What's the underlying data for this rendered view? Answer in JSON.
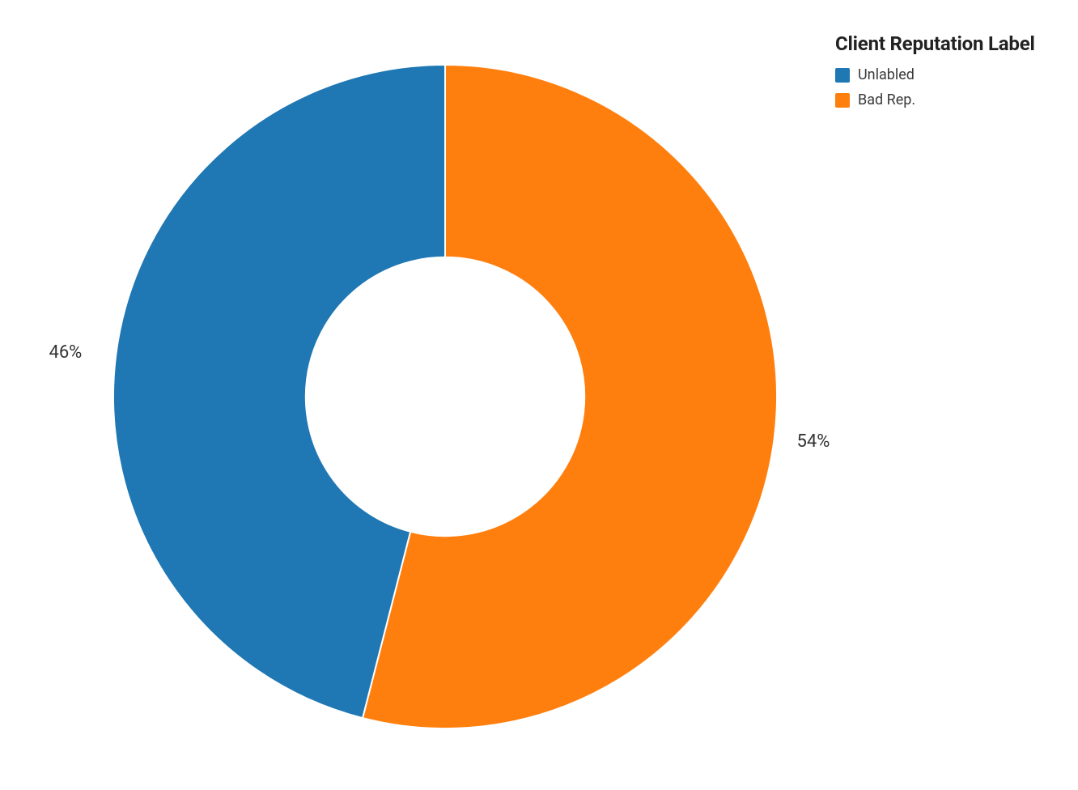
{
  "chart_data": {
    "type": "pie",
    "title": "",
    "legend_title": "Client Reputation Label",
    "inner_radius_ratio": 0.42,
    "series": [
      {
        "name": "Unlabled",
        "value": 46,
        "color": "#1f77b4",
        "display": "46%"
      },
      {
        "name": "Bad Rep.",
        "value": 54,
        "color": "#ff7f0e",
        "display": "54%"
      }
    ]
  }
}
